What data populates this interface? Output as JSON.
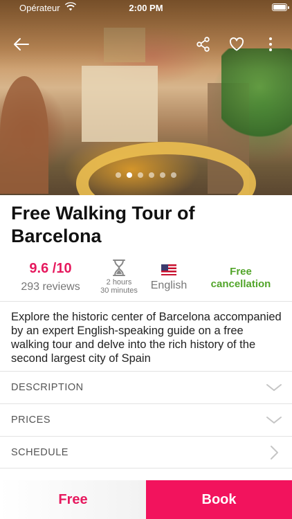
{
  "status_bar": {
    "carrier": "Opérateur",
    "time": "2:00 PM",
    "icons": [
      "wifi-icon",
      "battery-icon"
    ]
  },
  "nav": {
    "icons": [
      "back-arrow-icon",
      "share-icon",
      "heart-icon",
      "more-vertical-icon"
    ]
  },
  "gallery": {
    "slide_count": 6,
    "active_index": 1
  },
  "title": "Free Walking Tour of Barcelona",
  "info": {
    "rating": "9.6 /10",
    "reviews": "293 reviews",
    "duration": {
      "line1": "2 hours",
      "line2": "30 minutes",
      "icon": "hourglass-icon"
    },
    "language": {
      "label": "English",
      "icon": "us-flag-icon"
    },
    "cancellation": {
      "line1": "Free",
      "line2": "cancellation"
    }
  },
  "description": "Explore the historic center of Barcelona accompanied by an expert English-speaking guide on a free walking tour and delve into the rich history of the second largest city of Spain",
  "sections": [
    {
      "label": "DESCRIPTION",
      "icon": "chevron-down-icon"
    },
    {
      "label": "PRICES",
      "icon": "chevron-down-icon"
    },
    {
      "label": "SCHEDULE",
      "icon": "chevron-right-icon"
    }
  ],
  "actions": {
    "price": "Free",
    "book": "Book"
  },
  "colors": {
    "accent": "#e6195e",
    "book_bg": "#f2135d",
    "cancellation": "#52a52a"
  }
}
